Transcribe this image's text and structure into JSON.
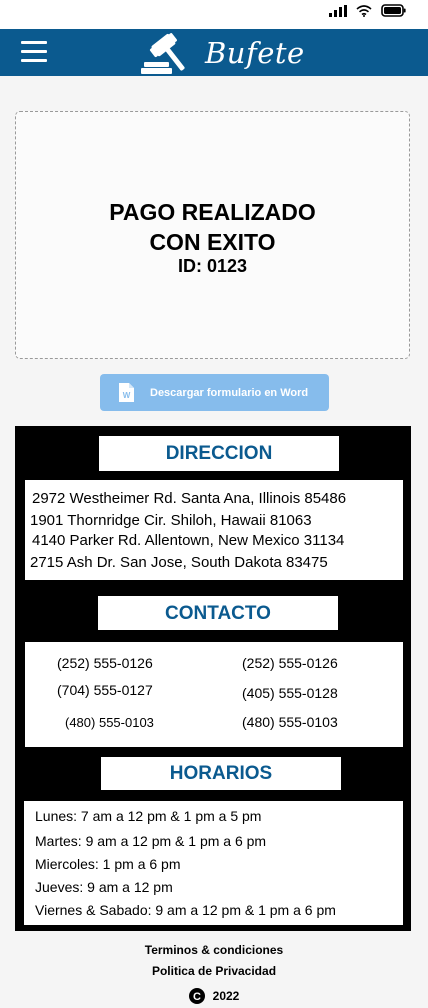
{
  "header": {
    "brand": "Bufete",
    "menu_icon": "hamburger-menu-icon",
    "logo_icon": "gavel-icon",
    "color": "#0b5a8f"
  },
  "status_bar": {
    "icons": [
      "signal-icon",
      "wifi-icon",
      "battery-icon"
    ]
  },
  "payment": {
    "title_line1": "PAGO REALIZADO",
    "title_line2": "CON EXITO",
    "id": "ID: 0123"
  },
  "download": {
    "label": "Descargar formulario en Word",
    "icon": "word-document-icon",
    "color": "#86bcec"
  },
  "address": {
    "title": "DIRECCION",
    "lines": [
      "2972 Westheimer Rd. Santa Ana, Illinois 85486",
      "1901 Thornridge Cir. Shiloh, Hawaii 81063",
      "4140 Parker Rd. Allentown, New Mexico 31134",
      "2715 Ash Dr. San Jose, South Dakota 83475"
    ]
  },
  "contact": {
    "title": "CONTACTO",
    "phones": [
      "(252) 555-0126",
      "(252) 555-0126",
      "(704) 555-0127",
      "(405) 555-0128",
      "(480) 555-0103",
      "(480) 555-0103"
    ]
  },
  "hours": {
    "title": "HORARIOS",
    "lines": [
      "Lunes: 7 am a 12 pm & 1 pm a 5 pm",
      "Martes: 9 am a 12 pm & 1 pm a 6 pm",
      "Miercoles: 1 pm a 6 pm",
      "Jueves: 9 am a 12 pm",
      "Viernes & Sabado: 9 am a 12 pm & 1 pm a 6 pm"
    ]
  },
  "footer": {
    "terms": "Terminos & condiciones",
    "privacy": "Politica de Privacidad",
    "year": "2022",
    "copyright_icon": "copyright-icon"
  }
}
